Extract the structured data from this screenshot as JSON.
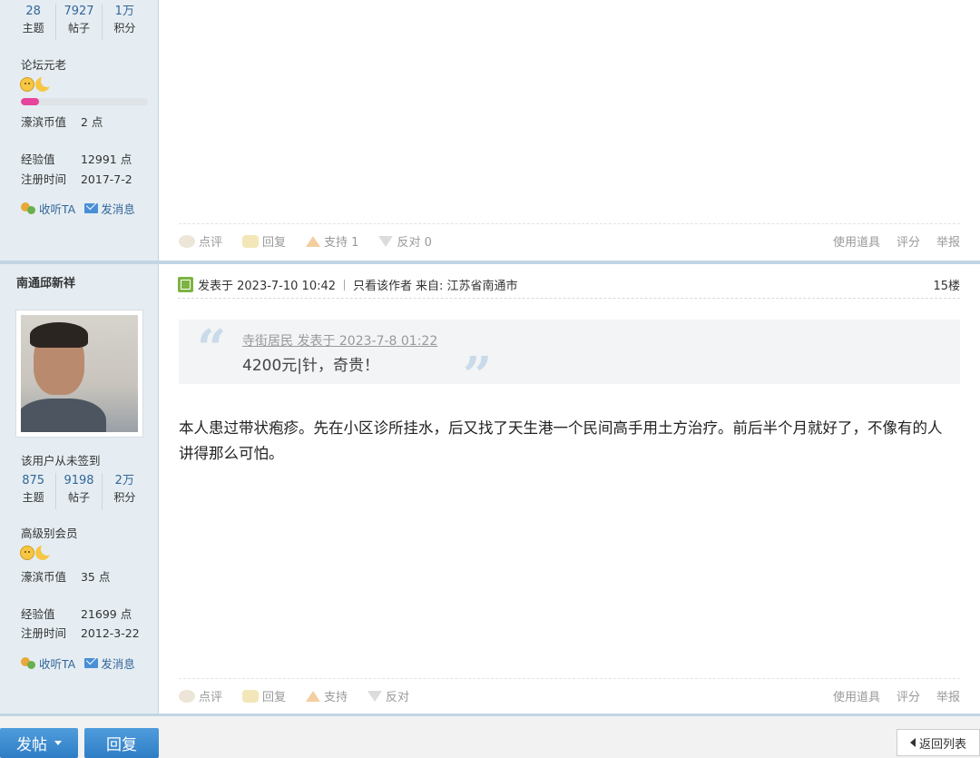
{
  "post1": {
    "stats": [
      {
        "num": "28",
        "label": "主题"
      },
      {
        "num": "7927",
        "label": "帖子"
      },
      {
        "num": "1万",
        "label": "积分"
      }
    ],
    "rank": "论坛元老",
    "level_progress": 0.14,
    "coins_label": "濠滨币值",
    "coins_value": "2 点",
    "exp_label": "经验值",
    "exp_value": "12991 点",
    "reg_label": "注册时间",
    "reg_value": "2017-7-2",
    "follow": "收听TA",
    "message": "发消息",
    "ops": {
      "comment": "点评",
      "reply": "回复",
      "support": "支持 1",
      "oppose": "反对 0",
      "tools": "使用道具",
      "rate": "评分",
      "report": "举报"
    }
  },
  "post2": {
    "username": "南通邱新祥",
    "signin": "该用户从未签到",
    "stats": [
      {
        "num": "875",
        "label": "主题"
      },
      {
        "num": "9198",
        "label": "帖子"
      },
      {
        "num": "2万",
        "label": "积分"
      }
    ],
    "rank": "高级别会员",
    "coins_label": "濠滨币值",
    "coins_value": "35 点",
    "exp_label": "经验值",
    "exp_value": "21699 点",
    "reg_label": "注册时间",
    "reg_value": "2012-3-22",
    "follow": "收听TA",
    "message": "发消息",
    "posted": "发表于 2023-7-10 10:42",
    "only_author": "只看该作者",
    "from": "来自: 江苏省南通市",
    "floor": "15楼",
    "quote_cite": "寺街居民 发表于 2023-7-8 01:22",
    "quote_text": "4200元|针，奇贵！",
    "body": "本人患过带状疱疹。先在小区诊所挂水，后又找了天生港一个民间高手用土方治疗。前后半个月就好了，不像有的人讲得那么可怕。",
    "ops": {
      "comment": "点评",
      "reply": "回复",
      "support": "支持",
      "oppose": "反对",
      "tools": "使用道具",
      "rate": "评分",
      "report": "举报"
    }
  },
  "footer": {
    "post_button": "发帖",
    "reply_button": "回复",
    "back_list": "返回列表"
  }
}
